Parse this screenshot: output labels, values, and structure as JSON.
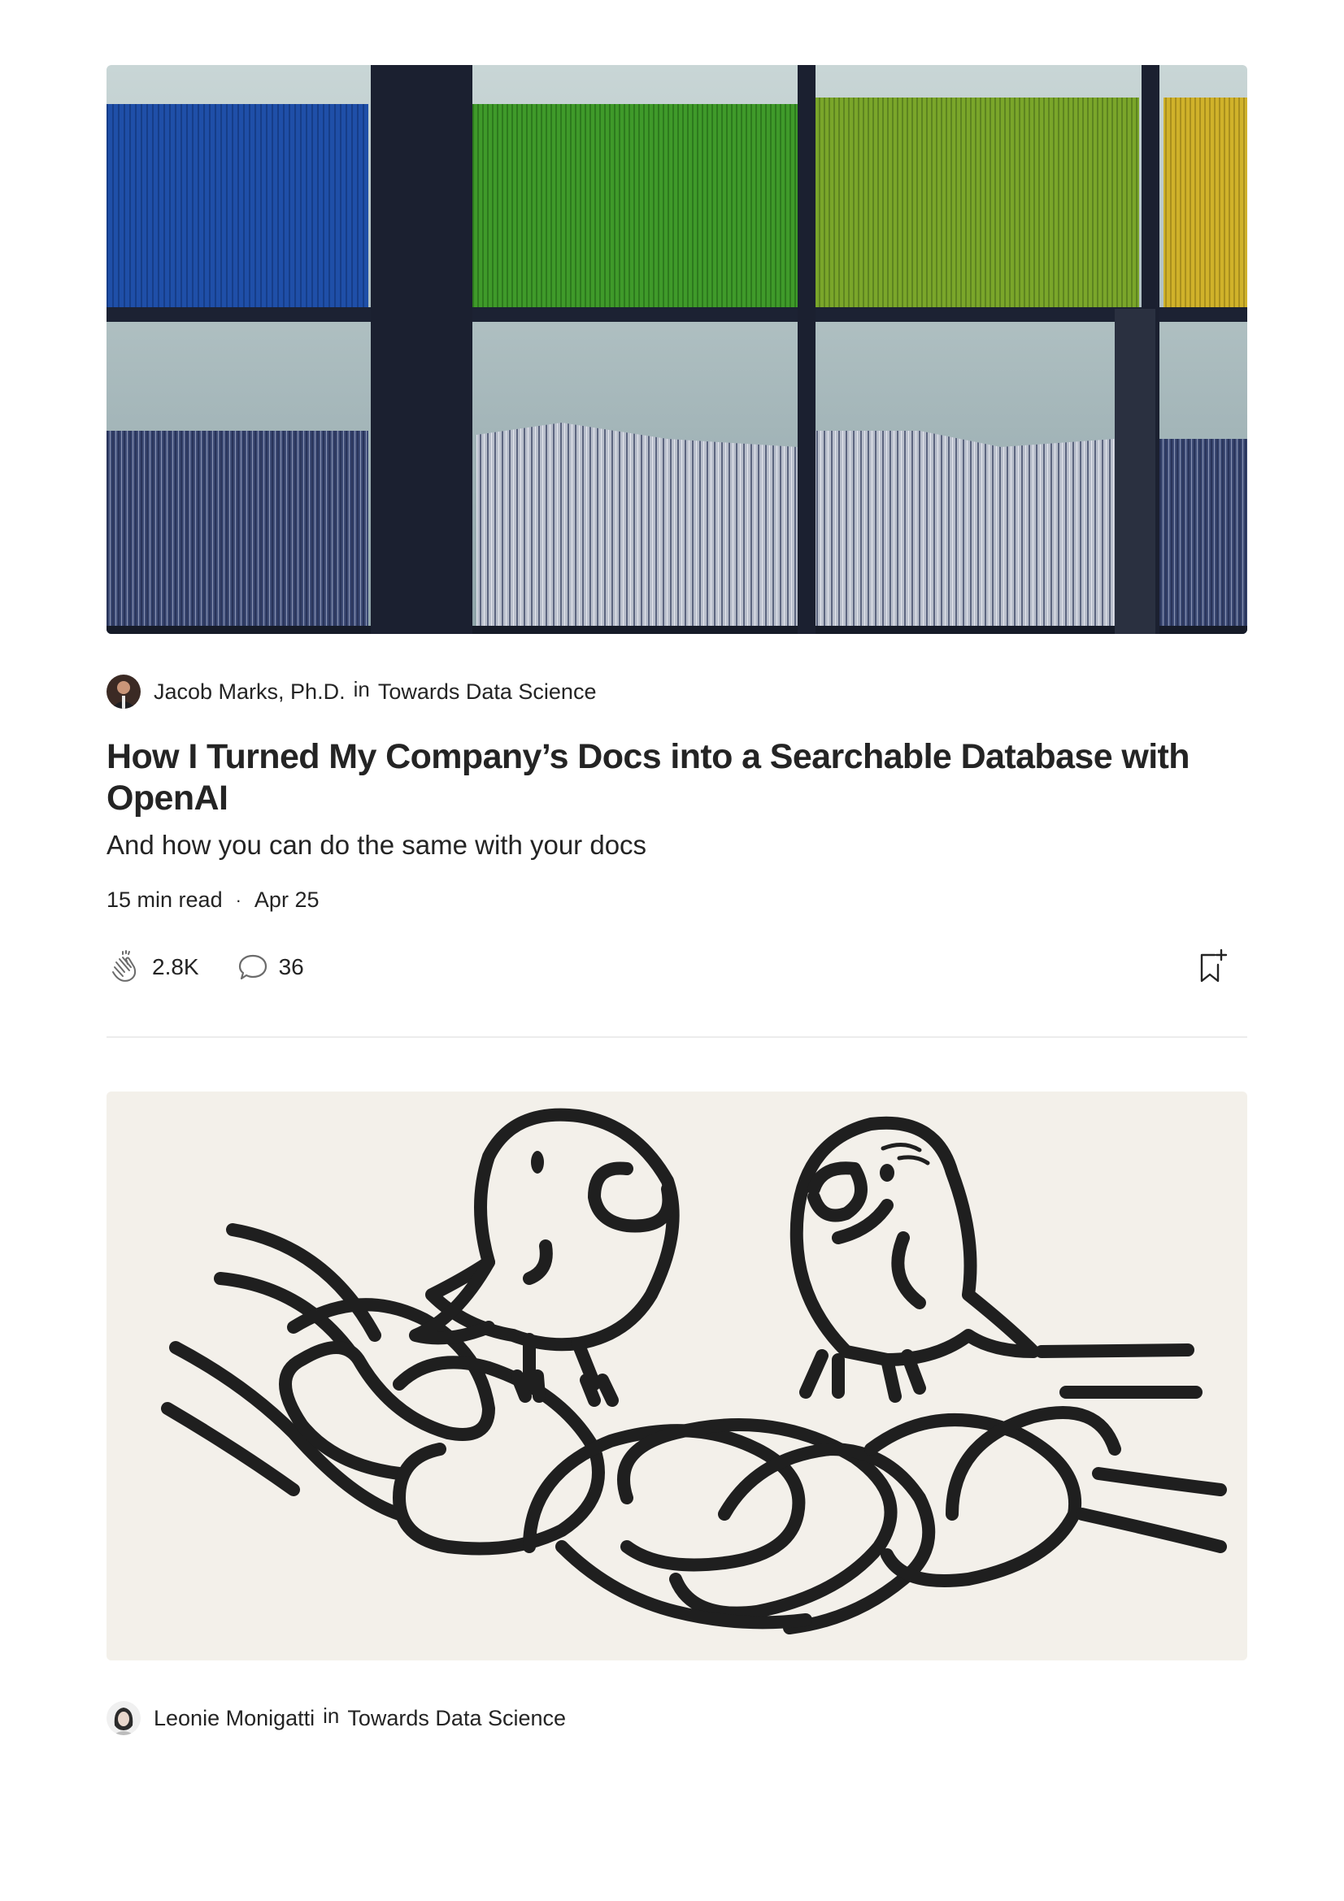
{
  "feed": {
    "articles": [
      {
        "author": "Jacob Marks, Ph.D.",
        "in_label": "in",
        "publication": "Towards Data Science",
        "title": "How I Turned My Company’s Docs into a Searchable Database with OpenAI",
        "subtitle": "And how you can do the same with your docs",
        "read_time": "15 min read",
        "separator": "·",
        "date": "Apr 25",
        "claps": "2.8K",
        "responses": "36",
        "image": "bookshelf-photo"
      },
      {
        "author": "Leonie Monigatti",
        "in_label": "in",
        "publication": "Towards Data Science",
        "image": "parrots-on-chain-illustration"
      }
    ]
  },
  "colors": {
    "text": "#242424",
    "divider": "#ececec",
    "illustration_bg": "#f3f0ea",
    "ink": "#1f1f1f"
  }
}
